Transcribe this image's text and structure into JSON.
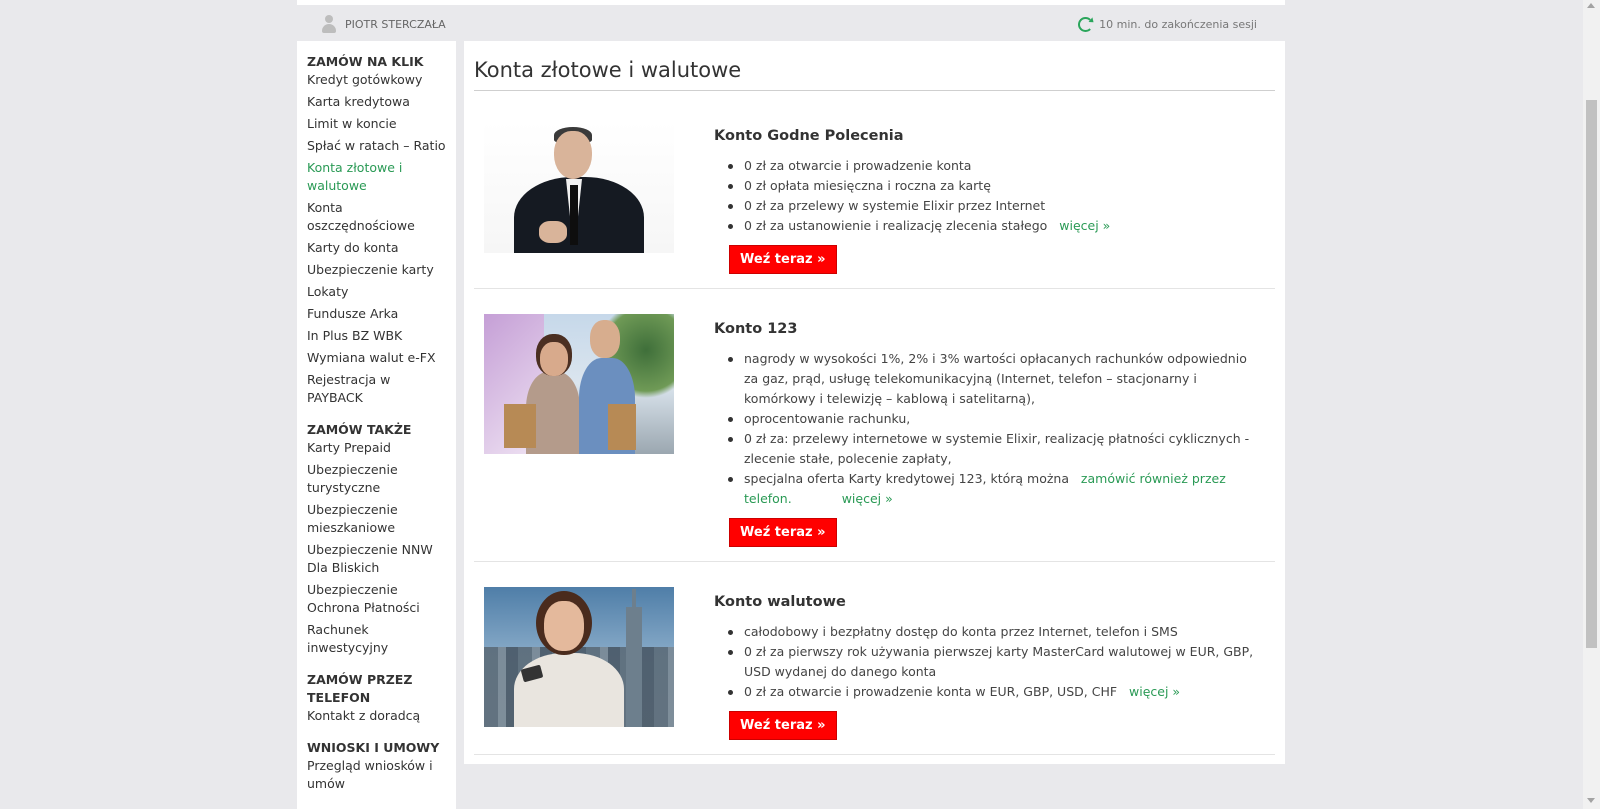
{
  "header": {
    "user_name": "PIOTR STERCZAŁA",
    "session": "10 min. do zakończenia sesji"
  },
  "sidebar": {
    "groups": [
      {
        "heading": "ZAMÓW NA KLIK",
        "items": [
          "Kredyt gotówkowy",
          "Karta kredytowa",
          "Limit w koncie",
          "Spłać w ratach – Ratio",
          "Konta złotowe i walutowe",
          "Konta oszczędnościowe",
          "Karty do konta",
          "Ubezpieczenie karty",
          "Lokaty",
          "Fundusze Arka",
          "In Plus BZ WBK",
          "Wymiana walut e-FX",
          "Rejestracja w PAYBACK"
        ]
      },
      {
        "heading": "ZAMÓW TAKŻE",
        "items": [
          "Karty Prepaid",
          "Ubezpieczenie turystyczne",
          "Ubezpieczenie mieszkaniowe",
          "Ubezpieczenie NNW Dla Bliskich",
          "Ubezpieczenie Ochrona Płatności",
          "Rachunek inwestycyjny"
        ]
      },
      {
        "heading": "ZAMÓW PRZEZ TELEFON",
        "items": [
          "Kontakt z doradcą"
        ]
      },
      {
        "heading": "WNIOSKI I UMOWY",
        "items": [
          "Przegląd wniosków i umów"
        ]
      }
    ],
    "active_item": "Konta złotowe i walutowe"
  },
  "main": {
    "title": "Konta złotowe i walutowe",
    "more_label": "więcej »",
    "button_label": "Weź teraz »",
    "products": [
      {
        "name": "Konto Godne Polecenia",
        "bullets": [
          "0 zł za otwarcie i prowadzenie konta",
          "0 zł opłata miesięczna i roczna za kartę",
          "0 zł za przelewy w systemie Elixir przez Internet",
          "0 zł za ustanowienie i realizację zlecenia stałego"
        ]
      },
      {
        "name": "Konto 123",
        "bullets": [
          "nagrody w wysokości 1%, 2% i 3% wartości opłacanych rachunków odpowiednio za gaz, prąd, usługę telekomunikacyjną (Internet, telefon – stacjonarny i komórkowy i telewizję – kablową i satelitarną),",
          "oprocentowanie rachunku,",
          "0 zł za: przelewy internetowe w systemie Elixir, realizację płatności cyklicznych - zlecenie stałe, polecenie zapłaty,",
          "specjalna oferta Karty kredytowej 123, którą można"
        ],
        "inline_link": "zamówić również przez telefon."
      },
      {
        "name": "Konto walutowe",
        "bullets": [
          "całodobowy i bezpłatny dostęp do konta przez Internet, telefon i SMS",
          "0 zł za pierwszy rok używania pierwszej karty MasterCard walutowej w EUR, GBP, USD wydanej do danego konta",
          "0 zł za otwarcie i prowadzenie konta w EUR, GBP, USD, CHF"
        ]
      }
    ]
  }
}
